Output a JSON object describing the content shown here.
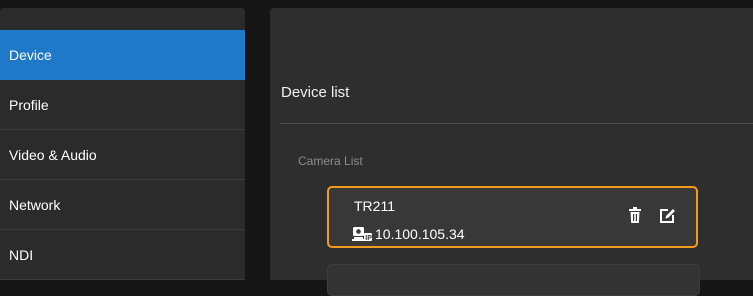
{
  "sidebar": {
    "items": [
      {
        "label": "Device",
        "active": true
      },
      {
        "label": "Profile",
        "active": false
      },
      {
        "label": "Video & Audio",
        "active": false
      },
      {
        "label": "Network",
        "active": false
      },
      {
        "label": "NDI",
        "active": false
      }
    ]
  },
  "main": {
    "title": "Device list",
    "section_label": "Camera List",
    "cameras": [
      {
        "name": "TR211",
        "ip": "10.100.105.34",
        "icon": "camera-ip-icon",
        "selected": true
      }
    ]
  },
  "colors": {
    "accent": "#1f79c9",
    "selection_border": "#f29b1e",
    "background": "#151515",
    "panel": "#2e2e2e"
  }
}
